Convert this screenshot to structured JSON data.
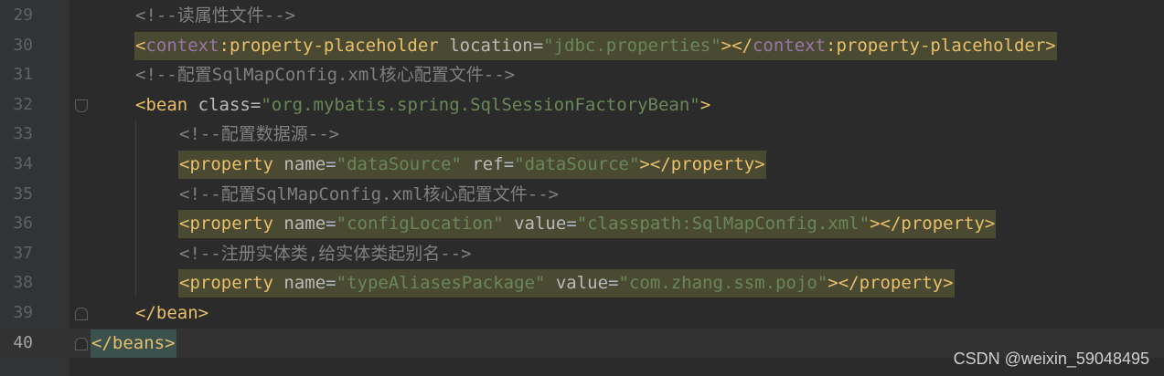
{
  "editor": {
    "lines": [
      {
        "number": "29",
        "text": "<!--读属性文件-->"
      },
      {
        "number": "30",
        "text": "<context:property-placeholder location=\"jdbc.properties\"></context:property-placeholder>"
      },
      {
        "number": "31",
        "text": "<!--配置SqlMapConfig.xml核心配置文件-->"
      },
      {
        "number": "32",
        "text": "<bean class=\"org.mybatis.spring.SqlSessionFactoryBean\">"
      },
      {
        "number": "33",
        "text": "<!--配置数据源-->"
      },
      {
        "number": "34",
        "text": "<property name=\"dataSource\" ref=\"dataSource\"></property>"
      },
      {
        "number": "35",
        "text": "<!--配置SqlMapConfig.xml核心配置文件-->"
      },
      {
        "number": "36",
        "text": "<property name=\"configLocation\" value=\"classpath:SqlMapConfig.xml\"></property>"
      },
      {
        "number": "37",
        "text": "<!--注册实体类,给实体类起别名-->"
      },
      {
        "number": "38",
        "text": "<property name=\"typeAliasesPackage\" value=\"com.zhang.ssm.pojo\"></property>"
      },
      {
        "number": "39",
        "text": "</bean>"
      },
      {
        "number": "40",
        "text": "</beans>"
      }
    ],
    "tokens": {
      "l29": "<!--读属性文件-->",
      "l30_open": "<",
      "l30_ns": "context",
      "l30_tag": ":property-placeholder",
      "l30_attr": "location",
      "l30_eq": "=",
      "l30_val": "\"jdbc.properties\"",
      "l30_close1": "></",
      "l30_ns2": "context",
      "l30_tag2": ":property-placeholder>",
      "l31": "<!--配置SqlMapConfig.xml核心配置文件-->",
      "l32_tag": "<bean",
      "l32_attr": "class",
      "l32_eq": "=",
      "l32_val": "\"org.mybatis.spring.SqlSessionFactoryBean\"",
      "l32_end": ">",
      "l33": "<!--配置数据源-->",
      "l34_tag": "<property",
      "l34_attr1": "name",
      "l34_val1": "\"dataSource\"",
      "l34_attr2": "ref",
      "l34_val2": "\"dataSource\"",
      "l34_end": "></property>",
      "l35": "<!--配置SqlMapConfig.xml核心配置文件-->",
      "l36_tag": "<property",
      "l36_attr1": "name",
      "l36_val1": "\"configLocation\"",
      "l36_attr2": "value",
      "l36_val2": "\"classpath:SqlMapConfig.xml\"",
      "l36_end": "></property>",
      "l37": "<!--注册实体类,给实体类起别名-->",
      "l38_tag": "<property",
      "l38_attr1": "name",
      "l38_val1": "\"typeAliasesPackage\"",
      "l38_attr2": "value",
      "l38_val2": "\"com.zhang.ssm.pojo\"",
      "l38_end": "></property>",
      "l39": "</bean>",
      "l40": "</beans>"
    }
  },
  "watermark": "CSDN @weixin_59048495"
}
